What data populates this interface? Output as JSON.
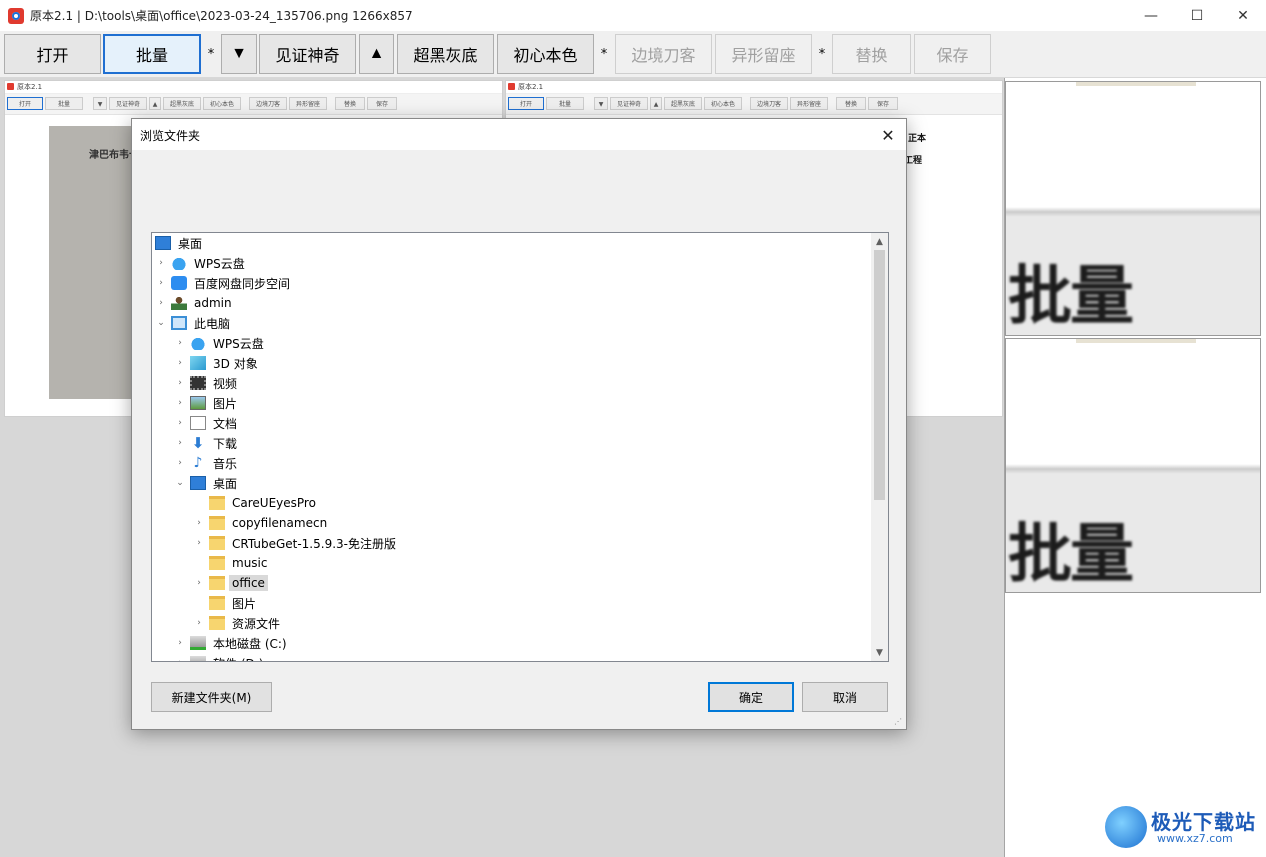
{
  "window": {
    "title": "原本2.1 | D:\\tools\\桌面\\office\\2023-03-24_135706.png 1266x857",
    "minimize": "—",
    "maximize": "☐",
    "close": "✕"
  },
  "toolbar": {
    "open": "打开",
    "batch": "批量",
    "sep1": "*",
    "down_arrow": "▼",
    "witness_magic": "见证神奇",
    "up_arrow": "▲",
    "super_black_gray": "超黑灰底",
    "original_color": "初心本色",
    "sep2": "*",
    "edge_blade": "边境刀客",
    "irregular_seat": "异形留座",
    "sep3": "*",
    "replace": "替换",
    "save": "保存"
  },
  "thumbnails": {
    "title": "原本2.1",
    "photo_text": "津巴布韦卡",
    "scan_text1": "正本",
    "scan_text2": "工程"
  },
  "zoom_preview": {
    "label": "批量"
  },
  "dialog": {
    "title": "浏览文件夹",
    "close": "✕",
    "tree": [
      {
        "label": "桌面",
        "icon": "desktop-icon",
        "level": 0,
        "chevron": ""
      },
      {
        "label": "WPS云盘",
        "icon": "cloud-icon",
        "level": 1,
        "chevron": "›"
      },
      {
        "label": "百度网盘同步空间",
        "icon": "baidu-sync-icon",
        "level": 1,
        "chevron": "›"
      },
      {
        "label": "admin",
        "icon": "user-icon",
        "level": 1,
        "chevron": "›"
      },
      {
        "label": "此电脑",
        "icon": "computer-icon",
        "level": 1,
        "chevron": "⌄"
      },
      {
        "label": "WPS云盘",
        "icon": "cloud-icon",
        "level": 2,
        "chevron": "›"
      },
      {
        "label": "3D 对象",
        "icon": "3d-objects-icon",
        "level": 2,
        "chevron": "›"
      },
      {
        "label": "视频",
        "icon": "video-icon",
        "level": 2,
        "chevron": "›"
      },
      {
        "label": "图片",
        "icon": "pictures-icon",
        "level": 2,
        "chevron": "›"
      },
      {
        "label": "文档",
        "icon": "documents-icon",
        "level": 2,
        "chevron": "›"
      },
      {
        "label": "下载",
        "icon": "download-icon",
        "level": 2,
        "chevron": "›"
      },
      {
        "label": "音乐",
        "icon": "music-icon",
        "level": 2,
        "chevron": "›"
      },
      {
        "label": "桌面",
        "icon": "desktop-icon",
        "level": 2,
        "chevron": "⌄"
      },
      {
        "label": "CareUEyesPro",
        "icon": "folder-icon",
        "level": 3,
        "chevron": ""
      },
      {
        "label": "copyfilenamecn",
        "icon": "folder-icon",
        "level": 3,
        "chevron": "›"
      },
      {
        "label": "CRTubeGet-1.5.9.3-免注册版",
        "icon": "folder-icon",
        "level": 3,
        "chevron": "›"
      },
      {
        "label": "music",
        "icon": "folder-icon",
        "level": 3,
        "chevron": ""
      },
      {
        "label": "office",
        "icon": "folder-icon",
        "level": 3,
        "chevron": "›",
        "selected": true
      },
      {
        "label": "图片",
        "icon": "folder-icon",
        "level": 3,
        "chevron": ""
      },
      {
        "label": "资源文件",
        "icon": "folder-icon",
        "level": 3,
        "chevron": "›"
      },
      {
        "label": "本地磁盘 (C:)",
        "icon": "disk-icon",
        "level": 2,
        "chevron": "›"
      },
      {
        "label": "软件 (D:)",
        "icon": "disk-icon",
        "level": 2,
        "chevron": "›"
      }
    ],
    "new_folder": "新建文件夹(M)",
    "ok": "确定",
    "cancel": "取消"
  },
  "watermark": {
    "brand": "极光下载站",
    "url": "www.xz7.com"
  }
}
